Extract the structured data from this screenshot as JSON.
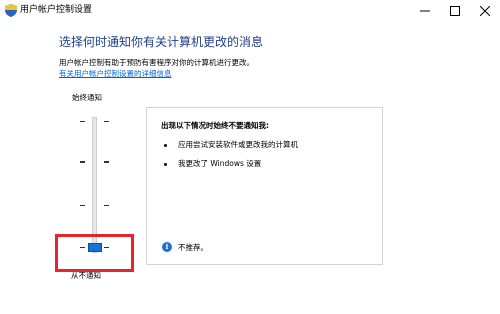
{
  "window": {
    "title": "用户帐户控制设置",
    "icon": "uac-shield-icon"
  },
  "main": {
    "heading": "选择何时通知你有关计算机更改的消息",
    "description": "用户帐户控制有助于预防有害程序对你的计算机进行更改。",
    "link": "有关用户帐户控制设置的详细信息"
  },
  "slider": {
    "top_label": "始终通知",
    "bottom_label": "从不通知",
    "levels": 4,
    "selected_level": 1
  },
  "panel": {
    "title": "出现以下情况时始终不要通知我:",
    "bullets": [
      "应用尝试安装软件或更改我的计算机",
      "我更改了 Windows 设置"
    ],
    "recommendation": "不推荐。"
  },
  "colors": {
    "heading": "#1e3f87",
    "link": "#0066cc",
    "slider_thumb": "#1673d5",
    "highlight": "#e8242b",
    "info_icon": "#1f6fd1"
  }
}
